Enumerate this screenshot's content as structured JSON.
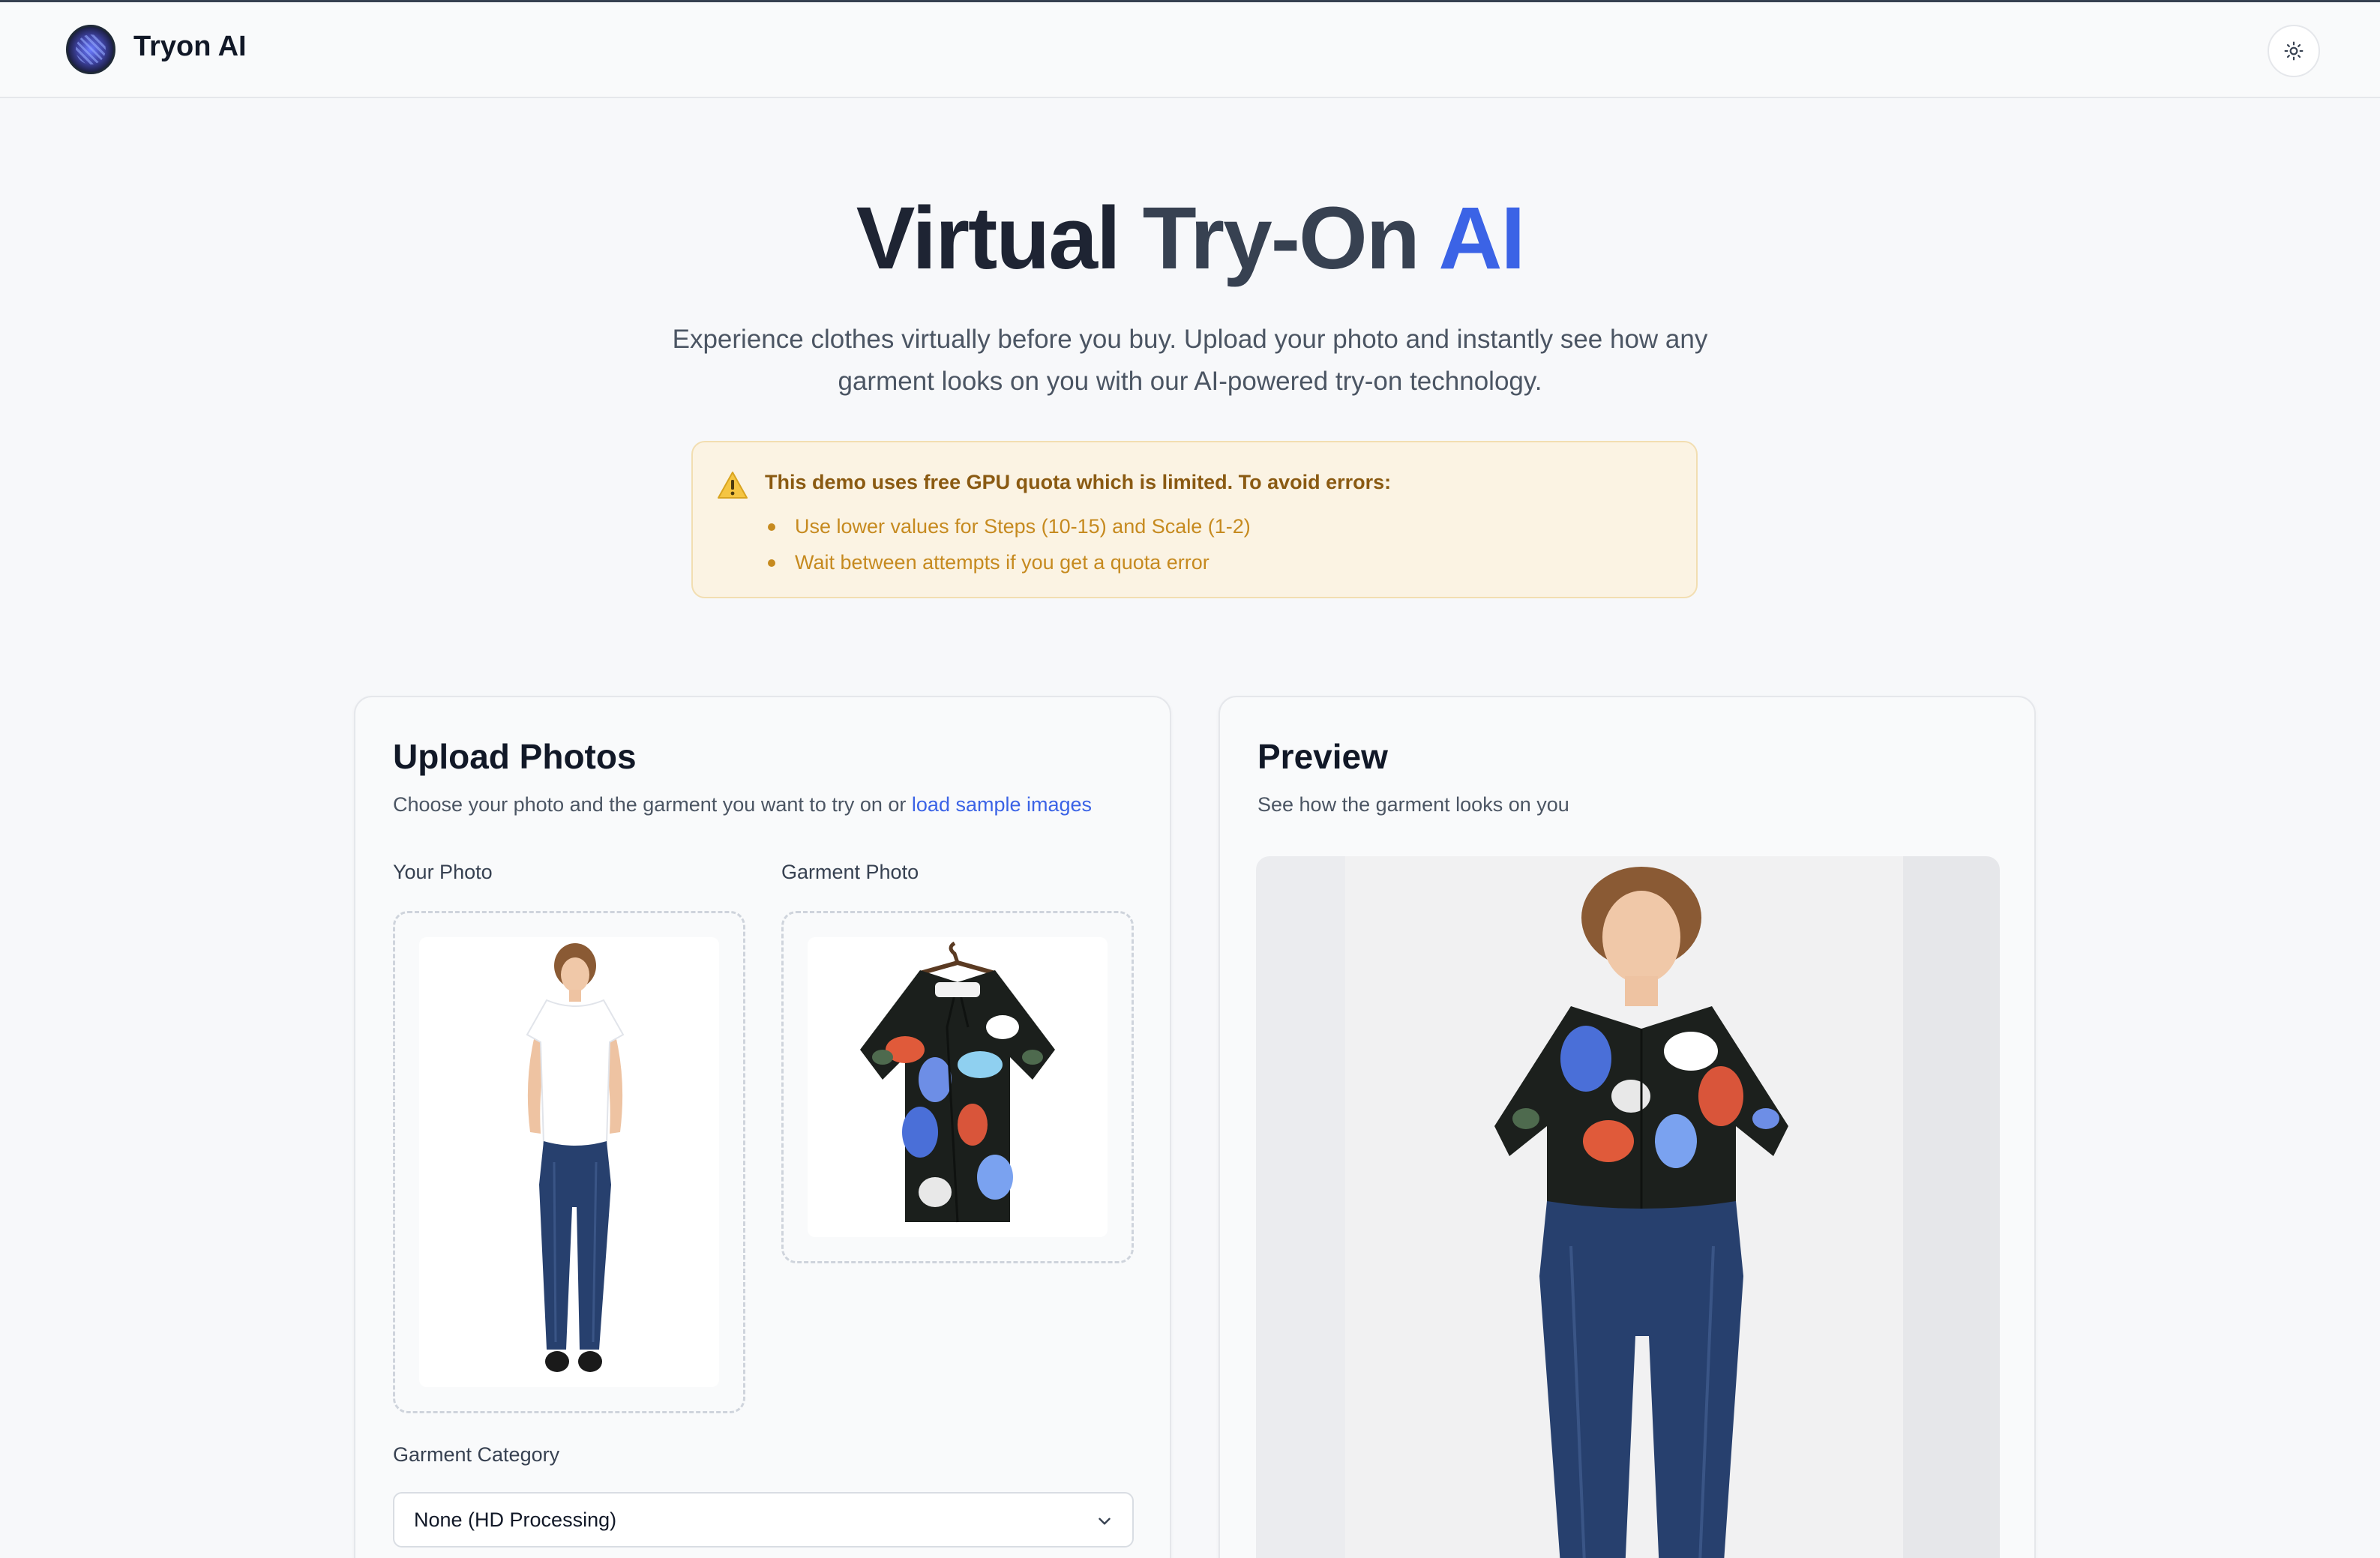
{
  "app": {
    "name": "Tryon AI"
  },
  "header": {
    "theme_toggle_icon": "sun-icon"
  },
  "hero": {
    "title_part1": "Virtual",
    "title_part2": "Try-On",
    "title_part3": "AI",
    "subtitle_line1": "Experience clothes virtually before you buy. Upload your photo and instantly see how any",
    "subtitle_line2": "garment looks on you with our AI-powered try-on technology."
  },
  "warning": {
    "title": "This demo uses free GPU quota which is limited. To avoid errors:",
    "items": [
      "Use lower values for Steps (10-15) and Scale (1-2)",
      "Wait between attempts if you get a quota error"
    ]
  },
  "upload": {
    "title": "Upload Photos",
    "description": "Choose your photo and the garment you want to try on or ",
    "sample_link": "load sample images",
    "your_photo_label": "Your Photo",
    "garment_photo_label": "Garment Photo",
    "category_label": "Garment Category",
    "category_value": "None (HD Processing)"
  },
  "preview": {
    "title": "Preview",
    "description": "See how the garment looks on you"
  },
  "colors": {
    "accent": "#3b63e6",
    "warning_bg": "#fbf3e3",
    "warning_text": "#c68a1f"
  }
}
